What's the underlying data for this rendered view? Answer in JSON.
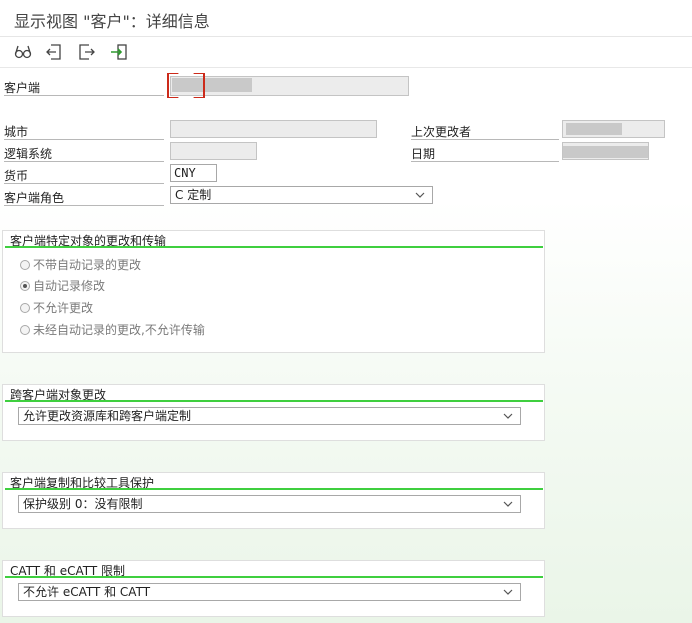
{
  "window": {
    "title": "显示视图 \"客户\"：详细信息"
  },
  "toolbar": {
    "icons": [
      "glasses-icon",
      "back-arrow-icon",
      "forward-arrow-icon",
      "transport-icon"
    ]
  },
  "form": {
    "client_label": "客户端",
    "client_value": "",
    "city_label": "城市",
    "city_value": "",
    "last_changed_by_label": "上次更改者",
    "last_changed_by_value": "",
    "logical_system_label": "逻辑系统",
    "logical_system_value": "",
    "date_label": "日期",
    "date_value": "",
    "currency_label": "货币",
    "currency_value": "CNY",
    "client_role_label": "客户端角色",
    "client_role_value": "C 定制"
  },
  "groups": {
    "changes": {
      "title": "客户端特定对象的更改和传输",
      "options": [
        {
          "label": "不带自动记录的更改",
          "selected": false
        },
        {
          "label": "自动记录修改",
          "selected": true
        },
        {
          "label": "不允许更改",
          "selected": false
        },
        {
          "label": "未经自动记录的更改,不允许传输",
          "selected": false
        }
      ]
    },
    "cross_client": {
      "title": "跨客户端对象更改",
      "value": "允许更改资源库和跨客户端定制"
    },
    "copy_protection": {
      "title": "客户端复制和比较工具保护",
      "value": "保护级别 0：没有限制"
    },
    "catt": {
      "title": "CATT 和 eCATT 限制",
      "value": "不允许 eCATT 和 CATT"
    }
  },
  "colors": {
    "group_accent": "#3fcf3f",
    "focus": "#cc2a1a"
  }
}
